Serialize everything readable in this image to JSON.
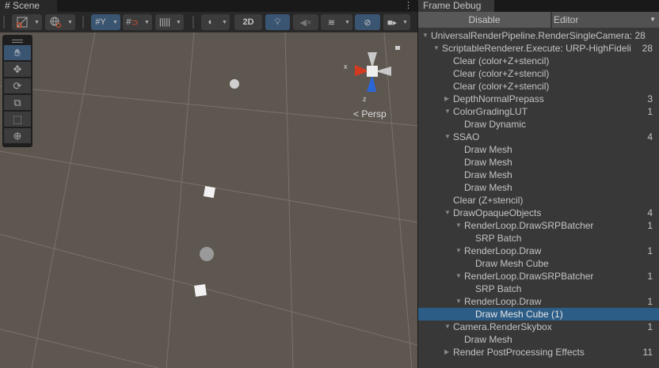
{
  "scene": {
    "tab_label": "Scene",
    "toggle_2d": "2D",
    "gizmo": {
      "x_label": "x",
      "z_label": "z",
      "persp_label": "Persp"
    }
  },
  "frame_debug": {
    "tab_label": "Frame Debug",
    "disable_label": "Disable",
    "target_select": "Editor",
    "selected_index": 22,
    "rows": [
      {
        "label": "UniversalRenderPipeline.RenderSingleCamera: 28",
        "level": 0,
        "arrow": "down",
        "count": ""
      },
      {
        "label": "ScriptableRenderer.Execute: URP-HighFideli",
        "level": 1,
        "arrow": "down",
        "count": "28"
      },
      {
        "label": "Clear (color+Z+stencil)",
        "level": 2,
        "arrow": "",
        "count": ""
      },
      {
        "label": "Clear (color+Z+stencil)",
        "level": 2,
        "arrow": "",
        "count": ""
      },
      {
        "label": "Clear (color+Z+stencil)",
        "level": 2,
        "arrow": "",
        "count": ""
      },
      {
        "label": "DepthNormalPrepass",
        "level": 2,
        "arrow": "right",
        "count": "3"
      },
      {
        "label": "ColorGradingLUT",
        "level": 2,
        "arrow": "down",
        "count": "1"
      },
      {
        "label": "Draw Dynamic",
        "level": 3,
        "arrow": "",
        "count": ""
      },
      {
        "label": "SSAO",
        "level": 2,
        "arrow": "down",
        "count": "4"
      },
      {
        "label": "Draw Mesh",
        "level": 3,
        "arrow": "",
        "count": ""
      },
      {
        "label": "Draw Mesh",
        "level": 3,
        "arrow": "",
        "count": ""
      },
      {
        "label": "Draw Mesh",
        "level": 3,
        "arrow": "",
        "count": ""
      },
      {
        "label": "Draw Mesh",
        "level": 3,
        "arrow": "",
        "count": ""
      },
      {
        "label": "Clear (Z+stencil)",
        "level": 2,
        "arrow": "",
        "count": ""
      },
      {
        "label": "DrawOpaqueObjects",
        "level": 2,
        "arrow": "down",
        "count": "4"
      },
      {
        "label": "RenderLoop.DrawSRPBatcher",
        "level": 3,
        "arrow": "down",
        "count": "1"
      },
      {
        "label": "SRP Batch",
        "level": 4,
        "arrow": "",
        "count": ""
      },
      {
        "label": "RenderLoop.Draw",
        "level": 3,
        "arrow": "down",
        "count": "1"
      },
      {
        "label": "Draw Mesh Cube",
        "level": 4,
        "arrow": "",
        "count": ""
      },
      {
        "label": "RenderLoop.DrawSRPBatcher",
        "level": 3,
        "arrow": "down",
        "count": "1"
      },
      {
        "label": "SRP Batch",
        "level": 4,
        "arrow": "",
        "count": ""
      },
      {
        "label": "RenderLoop.Draw",
        "level": 3,
        "arrow": "down",
        "count": "1"
      },
      {
        "label": "Draw Mesh Cube (1)",
        "level": 4,
        "arrow": "",
        "count": ""
      },
      {
        "label": "Camera.RenderSkybox",
        "level": 2,
        "arrow": "down",
        "count": "1"
      },
      {
        "label": "Draw Mesh",
        "level": 3,
        "arrow": "",
        "count": ""
      },
      {
        "label": "Render PostProcessing Effects",
        "level": 2,
        "arrow": "right",
        "count": "11"
      }
    ]
  }
}
